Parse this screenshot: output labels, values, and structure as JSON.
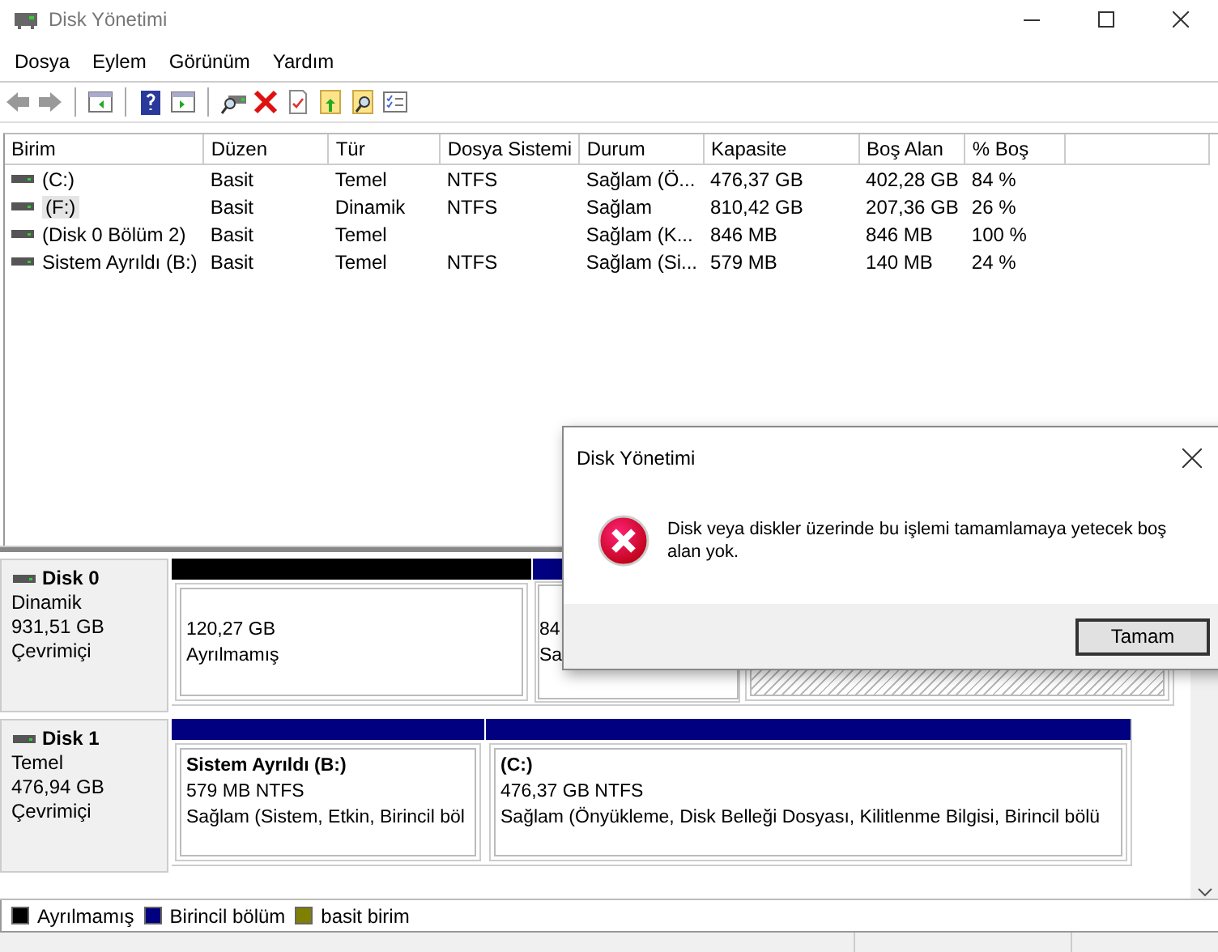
{
  "window": {
    "title": "Disk Yönetimi"
  },
  "menu": [
    "Dosya",
    "Eylem",
    "Görünüm",
    "Yardım"
  ],
  "table": {
    "columns": [
      "Birim",
      "Düzen",
      "Tür",
      "Dosya Sistemi",
      "Durum",
      "Kapasite",
      "Boş Alan",
      "% Boş"
    ],
    "rows": [
      {
        "cells": [
          "(C:)",
          "Basit",
          "Temel",
          "NTFS",
          "Sağlam (Ö...",
          "476,37 GB",
          "402,28 GB",
          "84 %"
        ],
        "selected": false
      },
      {
        "cells": [
          "(F:)",
          "Basit",
          "Dinamik",
          "NTFS",
          "Sağlam",
          "810,42 GB",
          "207,36 GB",
          "26 %"
        ],
        "selected": true
      },
      {
        "cells": [
          "(Disk 0 Bölüm 2)",
          "Basit",
          "Temel",
          "",
          "Sağlam (K...",
          "846 MB",
          "846 MB",
          "100 %"
        ],
        "selected": false
      },
      {
        "cells": [
          "Sistem Ayrıldı (B:)",
          "Basit",
          "Temel",
          "NTFS",
          "Sağlam (Si...",
          "579 MB",
          "140 MB",
          "24 %"
        ],
        "selected": false
      }
    ]
  },
  "disks": [
    {
      "name": "Disk 0",
      "type": "Dinamik",
      "size": "931,51 GB",
      "status": "Çevrimiçi",
      "partitions": [
        {
          "color": "#000000",
          "selected": false,
          "lines": [
            "120,27 GB",
            "Ayrılmamış"
          ]
        },
        {
          "color": "#000080",
          "selected": false,
          "lines": [
            "84",
            "Sa"
          ]
        },
        {
          "selected": true
        }
      ]
    },
    {
      "name": "Disk 1",
      "type": "Temel",
      "size": "476,94 GB",
      "status": "Çevrimiçi",
      "partitions": [
        {
          "color": "#000080",
          "selected": false,
          "title": "Sistem Ayrıldı  (B:)",
          "lines": [
            "579 MB NTFS",
            "Sağlam (Sistem, Etkin, Birincil böl"
          ]
        },
        {
          "color": "#000080",
          "selected": false,
          "title": "(C:)",
          "lines": [
            "476,37 GB NTFS",
            "Sağlam (Önyükleme, Disk Belleği Dosyası, Kilitlenme Bilgisi, Birincil bölü"
          ]
        }
      ]
    }
  ],
  "legend": [
    {
      "label": "Ayrılmamış",
      "color": "#000000"
    },
    {
      "label": "Birincil bölüm",
      "color": "#000080"
    },
    {
      "label": "basit birim",
      "color": "#808000"
    }
  ],
  "dialog": {
    "title": "Disk Yönetimi",
    "message": "Disk veya diskler üzerinde bu işlemi tamamlamaya yetecek boş alan yok.",
    "button": "Tamam"
  }
}
